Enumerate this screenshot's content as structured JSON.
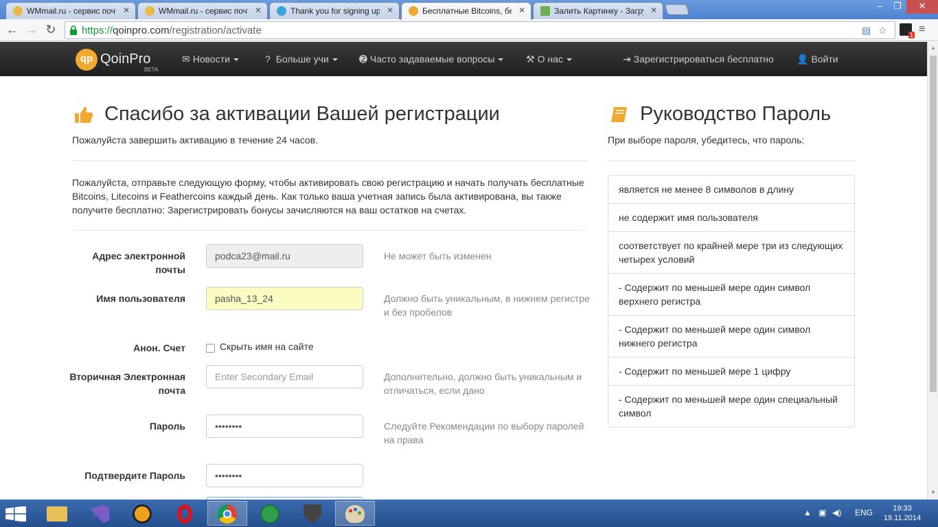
{
  "browser": {
    "tabs": [
      {
        "title": "WMmail.ru - сервис почт",
        "icon": "wmmail-icon",
        "active": false
      },
      {
        "title": "WMmail.ru - сервис почт",
        "icon": "wmmail-icon",
        "active": false
      },
      {
        "title": "Thank you for signing up",
        "icon": "site-icon",
        "active": false
      },
      {
        "title": "Бесплатные Bitcoins, бес",
        "icon": "qoinpro-icon",
        "active": true
      },
      {
        "title": "Залить Картинку - Загру",
        "icon": "image-upload-icon",
        "active": false
      }
    ],
    "url_scheme": "https://",
    "url_host": "qoinpro.com",
    "url_path": "/registration/activate",
    "extension_badge": "1"
  },
  "site_nav": {
    "logo_mark": "qp",
    "logo_text": "QoinPro",
    "logo_beta": "BETA",
    "items": [
      {
        "label": "Новости",
        "icon": "envelope-icon",
        "dropdown": true
      },
      {
        "label": "Больше учи",
        "icon": "question-icon",
        "dropdown": true
      },
      {
        "label": "Часто задаваемые вопросы",
        "icon": "question-circle-icon",
        "dropdown": true
      },
      {
        "label": "О нас",
        "icon": "gavel-icon",
        "dropdown": true
      }
    ],
    "register_label": "Зарегистрироваться бесплатно",
    "login_label": "Войти"
  },
  "main": {
    "title": "Спасибо за активации Вашей регистрации",
    "subtitle": "Пожалуйста завершить активацию в течение 24 часов.",
    "intro": "Пожалуйста, отправьте следующую форму, чтобы активировать свою регистрацию и начать получать бесплатные Bitcoins, Litecoins и Feathercoins каждый день. Как только ваша учетная запись была активирована, вы также получите бесплатно: Зарегистрировать бонусы зачисляются на ваш остатков на счетах.",
    "form": {
      "email_label": "Адрес электронной почты",
      "email_value": "podca23@mail.ru",
      "email_help": "Не может быть изменен",
      "username_label": "Имя пользователя",
      "username_value": "pasha_13_24",
      "username_help": "Должно быть уникальным, в нижнем регистре и без пробелов",
      "anon_label": "Анон. Счет",
      "anon_checkbox_label": "Скрыть имя на сайте",
      "secondary_label": "Вторичная Электронная почта",
      "secondary_placeholder": "Enter Secondary Email",
      "secondary_help": "Дополнительно, должно быть уникальным и отличаться, если дано",
      "password_label": "Пароль",
      "password_value": "••••••••",
      "password_help": "Следуйте Рекомендации по выбору паролей на права",
      "confirm_label": "Подтвердите Пароль",
      "confirm_value": "••••••••"
    }
  },
  "sidebar": {
    "title": "Руководство Пароль",
    "subtitle": "При выборе пароля, убедитесь, что пароль:",
    "rules": [
      "является не менее 8 символов в длину",
      "не содержит имя пользователя",
      "соответствует по крайней мере три из следующих четырех условий",
      "- Содержит по меньшей мере один символ верхнего регистра",
      "- Содержит по меньшей мере один символ нижнего регистра",
      "- Содержит по меньшей мере 1 цифру",
      "- Содержит по меньшей мере один специальный символ"
    ]
  },
  "taskbar": {
    "apps": [
      "file-explorer-icon",
      "visual-studio-icon",
      "aimp-icon",
      "opera-icon",
      "chrome-icon",
      "utorrent-icon",
      "world-of-tanks-icon",
      "paint-icon"
    ],
    "language": "ENG",
    "time": "19:33",
    "date": "19.11.2014"
  },
  "colors": {
    "accent_gold": "#f0a830",
    "nav_bg": "#222222",
    "autofill_yellow": "#fafcc2"
  }
}
